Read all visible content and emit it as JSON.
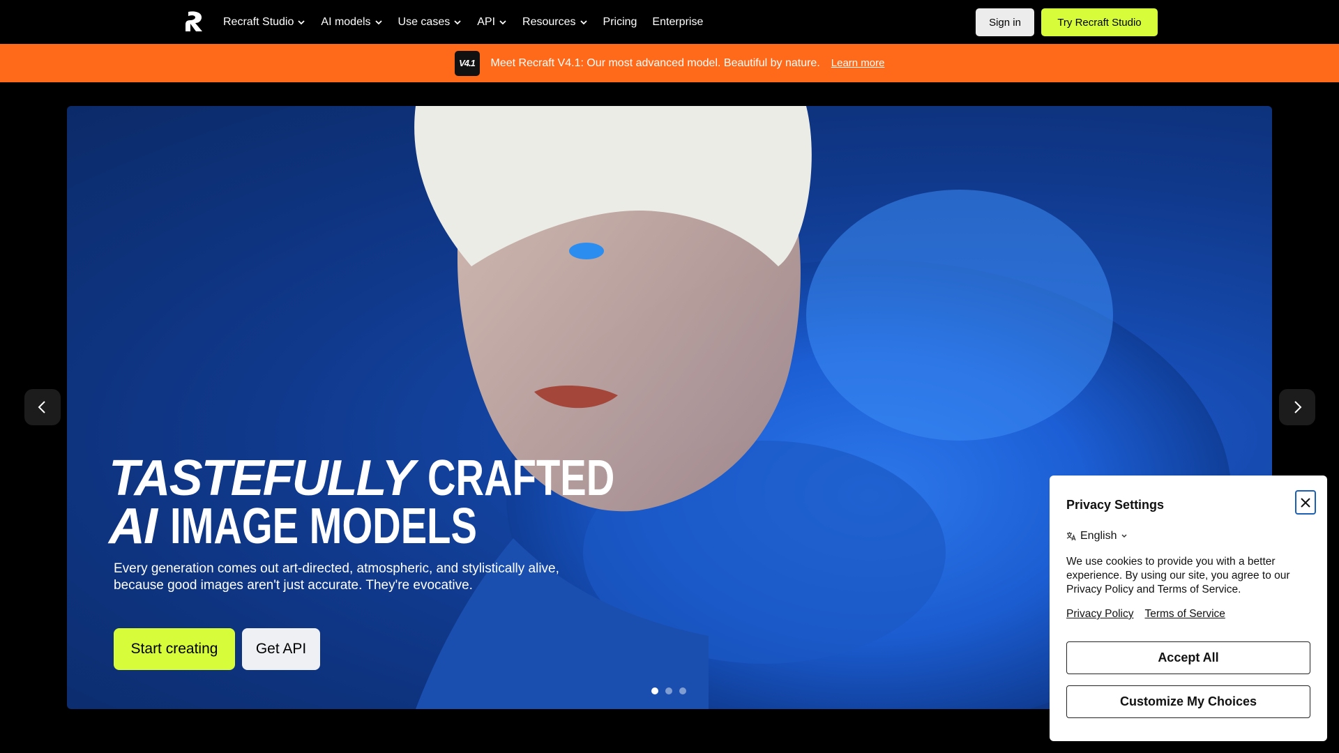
{
  "nav": {
    "logo_icon": "recraft-logo-icon",
    "items": [
      {
        "label": "Recraft Studio",
        "dropdown": true
      },
      {
        "label": "AI models",
        "dropdown": true
      },
      {
        "label": "Use cases",
        "dropdown": true
      },
      {
        "label": "API",
        "dropdown": true
      },
      {
        "label": "Resources",
        "dropdown": true
      },
      {
        "label": "Pricing",
        "dropdown": false
      },
      {
        "label": "Enterprise",
        "dropdown": false
      }
    ],
    "sign_in": "Sign in",
    "try_studio": "Try Recraft Studio",
    "accent_color": "#d7fc3a"
  },
  "banner": {
    "badge": "V4.1",
    "text": "Meet Recraft V4.1: Our most advanced model. Beautiful by nature.",
    "link": "Learn more",
    "color": "#ff6a1a"
  },
  "hero": {
    "headline_1a": "TASTEFULLY",
    "headline_1b": "CRAFTED",
    "headline_2a": "AI",
    "headline_2b": "IMAGE MODELS",
    "subtitle": "Every generation comes out art-directed, atmospheric, and stylistically alive, because good images aren't just accurate. They're evocative.",
    "cta_primary": "Start creating",
    "cta_secondary": "Get API",
    "slides": 3,
    "active_slide": 1
  },
  "privacy": {
    "title": "Privacy Settings",
    "language": "English",
    "text": "We use cookies to provide you with a better experience. By using our site, you agree to our Privacy Policy and Terms of Service.",
    "link_privacy": "Privacy Policy",
    "link_terms": "Terms of Service",
    "accept": "Accept All",
    "customize": "Customize My Choices"
  }
}
